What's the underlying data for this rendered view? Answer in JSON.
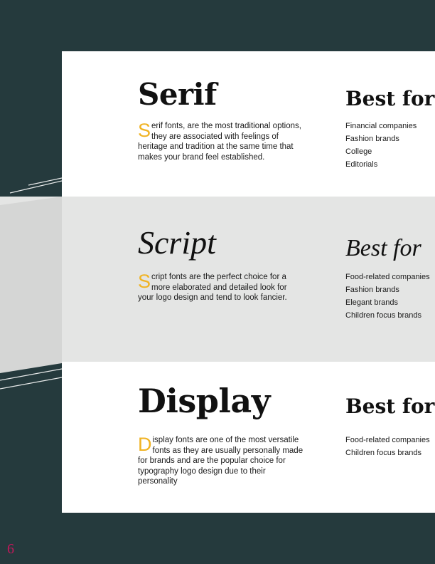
{
  "sections": {
    "serif": {
      "heading": "Serif",
      "dropcap": "S",
      "text": "erif fonts, are the most traditional options, they are associated with feelings of heritage and tradition at the same time that makes your brand feel established.",
      "best_for_label": "Best for",
      "items": [
        "Financial companies",
        "Fashion brands",
        "College",
        "Editorials"
      ]
    },
    "script": {
      "heading": "Script",
      "dropcap": "S",
      "text": "cript fonts are the perfect choice for  a more elaborated and detailed look for your logo design and tend to look fancier.",
      "best_for_label": "Best for",
      "items": [
        "Food-related companies",
        "Fashion brands",
        "Elegant brands",
        "Children focus brands"
      ]
    },
    "display": {
      "heading": "Display",
      "dropcap": "D",
      "text": "isplay fonts are one of the most versatile fonts as they are usually personally made for brands and are the popular choice for typography logo design due to their personality",
      "best_for_label": "Best for",
      "items": [
        "Food-related companies",
        "Children focus brands"
      ]
    }
  },
  "page_number": "6",
  "colors": {
    "background": "#253a3d",
    "accent_dropcap": "#f0b323",
    "page_number": "#c2185b",
    "band_gray": "#e4e5e4"
  }
}
